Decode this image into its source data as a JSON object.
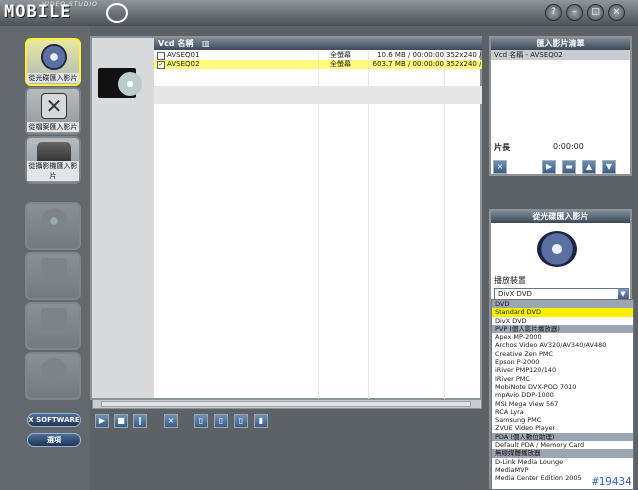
{
  "window": {
    "logo_text": "MOBILE",
    "logo_subtext": "VIDEO STUDIO",
    "buttons": [
      "help-icon",
      "minimize-icon",
      "restore-icon",
      "close-icon"
    ]
  },
  "sidebar": {
    "items": [
      {
        "label": "從光碟匯入影片",
        "icon": "disc-import-icon",
        "state": "active"
      },
      {
        "label": "從檔案匯入影片",
        "icon": "file-import-icon",
        "state": "normal"
      },
      {
        "label": "從攝影機匯入影片",
        "icon": "camcorder-import-icon",
        "state": "normal"
      },
      {
        "label": "",
        "icon": "disc-burn-icon",
        "state": "disabled"
      },
      {
        "label": "",
        "icon": "photo-edit-icon",
        "state": "disabled"
      },
      {
        "label": "",
        "icon": "edit-icon",
        "state": "disabled"
      },
      {
        "label": "",
        "icon": "disc-settings-icon",
        "state": "disabled"
      }
    ],
    "brand_button": "X SOFTWARE",
    "options_button": "選項"
  },
  "file_list": {
    "header": "Vcd 名稱",
    "rows": [
      {
        "checked": false,
        "name": "AVSEQ01",
        "subtitle": "全螢幕",
        "info": "10.6 MB / 00:00:00",
        "res": "352x240 /",
        "selected": false
      },
      {
        "checked": true,
        "name": "AVSEQ02",
        "subtitle": "全螢幕",
        "info": "603.7 MB / 00:00:00",
        "res": "352x240 /",
        "selected": true
      }
    ]
  },
  "import_list": {
    "title": "匯入影片清單",
    "items": [
      "Vcd 名稱 - AVSEQ02"
    ],
    "duration_label": "片長",
    "duration_value": "0:00:00"
  },
  "device_panel": {
    "title": "從光碟匯入影片",
    "device_label": "播放裝置",
    "selected_device": "DivX DVD",
    "options": [
      {
        "text": "DVD",
        "group": true
      },
      {
        "text": "Standard DVD",
        "selected": true
      },
      {
        "text": "DivX DVD"
      },
      {
        "text": "PVP (個人影片播放器)",
        "group": true
      },
      {
        "text": "Apex MP-2000"
      },
      {
        "text": "Archos Video AV320/AV340/AV480"
      },
      {
        "text": "Creative Zen PMC"
      },
      {
        "text": "Epson P-2000"
      },
      {
        "text": "iRiver PMP120/140"
      },
      {
        "text": "IRiver PMC"
      },
      {
        "text": "MobiNote DVX-POD 7010"
      },
      {
        "text": "mpAvio DDP-1000"
      },
      {
        "text": "MSI Mega View 567"
      },
      {
        "text": "RCA Lyra"
      },
      {
        "text": "Samsung PMC"
      },
      {
        "text": "ZVUE Video Player"
      },
      {
        "text": "PDA (個人數位助理)",
        "group": true
      },
      {
        "text": "Default PDA / Memory Card"
      },
      {
        "text": "無線媒體播放器",
        "group": true
      },
      {
        "text": "D-Link Media Lounge"
      },
      {
        "text": "MediaMVP"
      },
      {
        "text": "Media Center Edition 2005"
      }
    ]
  },
  "watermark": "#19434",
  "colors": {
    "selection": "#fff97c",
    "header": "#3d4a58",
    "active_border": "#ffef3a"
  }
}
